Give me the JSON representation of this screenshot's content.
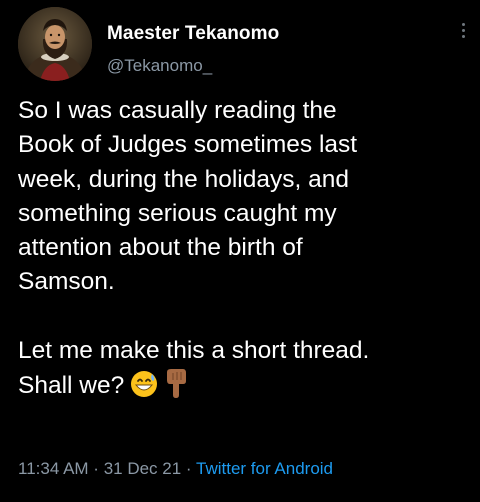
{
  "author": {
    "display_name": "Maester Tekanomo",
    "handle": "@Tekanomo_"
  },
  "tweet": {
    "paragraph1_lines": [
      "So I was casually reading the",
      "Book of Judges sometimes last",
      "week, during the holidays, and",
      "something serious caught my",
      "attention about the birth of",
      "Samson."
    ],
    "paragraph2_lines": [
      "Let me make this a short thread.",
      "Shall we?"
    ],
    "emojis": [
      "grinning-face-with-sweat-emoji",
      "backhand-index-pointing-down-emoji"
    ]
  },
  "meta": {
    "time": "11:34 AM",
    "separator": " · ",
    "date": "31 Dec 21",
    "source": "Twitter for Android"
  },
  "colors": {
    "background": "#000000",
    "text": "#ffffff",
    "secondary_text": "#8b98a5",
    "link": "#1d9bf0"
  }
}
